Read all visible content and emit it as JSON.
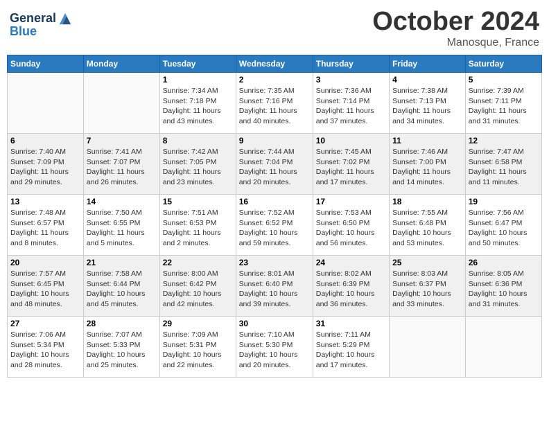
{
  "header": {
    "logo_line1": "General",
    "logo_line2": "Blue",
    "month": "October 2024",
    "location": "Manosque, France"
  },
  "weekdays": [
    "Sunday",
    "Monday",
    "Tuesday",
    "Wednesday",
    "Thursday",
    "Friday",
    "Saturday"
  ],
  "weeks": [
    [
      {
        "day": "",
        "info": ""
      },
      {
        "day": "",
        "info": ""
      },
      {
        "day": "1",
        "info": "Sunrise: 7:34 AM\nSunset: 7:18 PM\nDaylight: 11 hours and 43 minutes."
      },
      {
        "day": "2",
        "info": "Sunrise: 7:35 AM\nSunset: 7:16 PM\nDaylight: 11 hours and 40 minutes."
      },
      {
        "day": "3",
        "info": "Sunrise: 7:36 AM\nSunset: 7:14 PM\nDaylight: 11 hours and 37 minutes."
      },
      {
        "day": "4",
        "info": "Sunrise: 7:38 AM\nSunset: 7:13 PM\nDaylight: 11 hours and 34 minutes."
      },
      {
        "day": "5",
        "info": "Sunrise: 7:39 AM\nSunset: 7:11 PM\nDaylight: 11 hours and 31 minutes."
      }
    ],
    [
      {
        "day": "6",
        "info": "Sunrise: 7:40 AM\nSunset: 7:09 PM\nDaylight: 11 hours and 29 minutes."
      },
      {
        "day": "7",
        "info": "Sunrise: 7:41 AM\nSunset: 7:07 PM\nDaylight: 11 hours and 26 minutes."
      },
      {
        "day": "8",
        "info": "Sunrise: 7:42 AM\nSunset: 7:05 PM\nDaylight: 11 hours and 23 minutes."
      },
      {
        "day": "9",
        "info": "Sunrise: 7:44 AM\nSunset: 7:04 PM\nDaylight: 11 hours and 20 minutes."
      },
      {
        "day": "10",
        "info": "Sunrise: 7:45 AM\nSunset: 7:02 PM\nDaylight: 11 hours and 17 minutes."
      },
      {
        "day": "11",
        "info": "Sunrise: 7:46 AM\nSunset: 7:00 PM\nDaylight: 11 hours and 14 minutes."
      },
      {
        "day": "12",
        "info": "Sunrise: 7:47 AM\nSunset: 6:58 PM\nDaylight: 11 hours and 11 minutes."
      }
    ],
    [
      {
        "day": "13",
        "info": "Sunrise: 7:48 AM\nSunset: 6:57 PM\nDaylight: 11 hours and 8 minutes."
      },
      {
        "day": "14",
        "info": "Sunrise: 7:50 AM\nSunset: 6:55 PM\nDaylight: 11 hours and 5 minutes."
      },
      {
        "day": "15",
        "info": "Sunrise: 7:51 AM\nSunset: 6:53 PM\nDaylight: 11 hours and 2 minutes."
      },
      {
        "day": "16",
        "info": "Sunrise: 7:52 AM\nSunset: 6:52 PM\nDaylight: 10 hours and 59 minutes."
      },
      {
        "day": "17",
        "info": "Sunrise: 7:53 AM\nSunset: 6:50 PM\nDaylight: 10 hours and 56 minutes."
      },
      {
        "day": "18",
        "info": "Sunrise: 7:55 AM\nSunset: 6:48 PM\nDaylight: 10 hours and 53 minutes."
      },
      {
        "day": "19",
        "info": "Sunrise: 7:56 AM\nSunset: 6:47 PM\nDaylight: 10 hours and 50 minutes."
      }
    ],
    [
      {
        "day": "20",
        "info": "Sunrise: 7:57 AM\nSunset: 6:45 PM\nDaylight: 10 hours and 48 minutes."
      },
      {
        "day": "21",
        "info": "Sunrise: 7:58 AM\nSunset: 6:44 PM\nDaylight: 10 hours and 45 minutes."
      },
      {
        "day": "22",
        "info": "Sunrise: 8:00 AM\nSunset: 6:42 PM\nDaylight: 10 hours and 42 minutes."
      },
      {
        "day": "23",
        "info": "Sunrise: 8:01 AM\nSunset: 6:40 PM\nDaylight: 10 hours and 39 minutes."
      },
      {
        "day": "24",
        "info": "Sunrise: 8:02 AM\nSunset: 6:39 PM\nDaylight: 10 hours and 36 minutes."
      },
      {
        "day": "25",
        "info": "Sunrise: 8:03 AM\nSunset: 6:37 PM\nDaylight: 10 hours and 33 minutes."
      },
      {
        "day": "26",
        "info": "Sunrise: 8:05 AM\nSunset: 6:36 PM\nDaylight: 10 hours and 31 minutes."
      }
    ],
    [
      {
        "day": "27",
        "info": "Sunrise: 7:06 AM\nSunset: 5:34 PM\nDaylight: 10 hours and 28 minutes."
      },
      {
        "day": "28",
        "info": "Sunrise: 7:07 AM\nSunset: 5:33 PM\nDaylight: 10 hours and 25 minutes."
      },
      {
        "day": "29",
        "info": "Sunrise: 7:09 AM\nSunset: 5:31 PM\nDaylight: 10 hours and 22 minutes."
      },
      {
        "day": "30",
        "info": "Sunrise: 7:10 AM\nSunset: 5:30 PM\nDaylight: 10 hours and 20 minutes."
      },
      {
        "day": "31",
        "info": "Sunrise: 7:11 AM\nSunset: 5:29 PM\nDaylight: 10 hours and 17 minutes."
      },
      {
        "day": "",
        "info": ""
      },
      {
        "day": "",
        "info": ""
      }
    ]
  ]
}
